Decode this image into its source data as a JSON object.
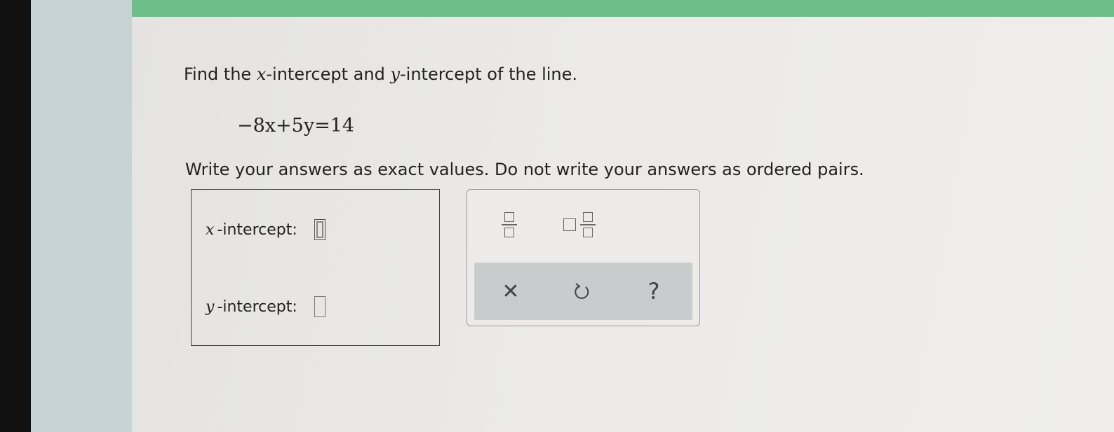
{
  "prompt": {
    "before_x": "Find the ",
    "x_var": "x",
    "between": "-intercept and ",
    "y_var": "y",
    "after_y": "-intercept of the line."
  },
  "equation": "−8x+5y=14",
  "instruction": "Write your answers as exact values. Do not write your answers as ordered pairs.",
  "answers": {
    "x_var": "x",
    "x_label": "-intercept:",
    "x_value": "",
    "y_var": "y",
    "y_label": "-intercept:",
    "y_value": ""
  },
  "palette": {
    "buttons": [
      "fraction-icon",
      "mixed-number-icon"
    ],
    "actions": {
      "clear_glyph": "✕",
      "undo_icon": "undo-icon",
      "help_glyph": "?"
    }
  },
  "colors": {
    "top_bar": "#6dbe88",
    "action_bar": "#c9cccd"
  }
}
